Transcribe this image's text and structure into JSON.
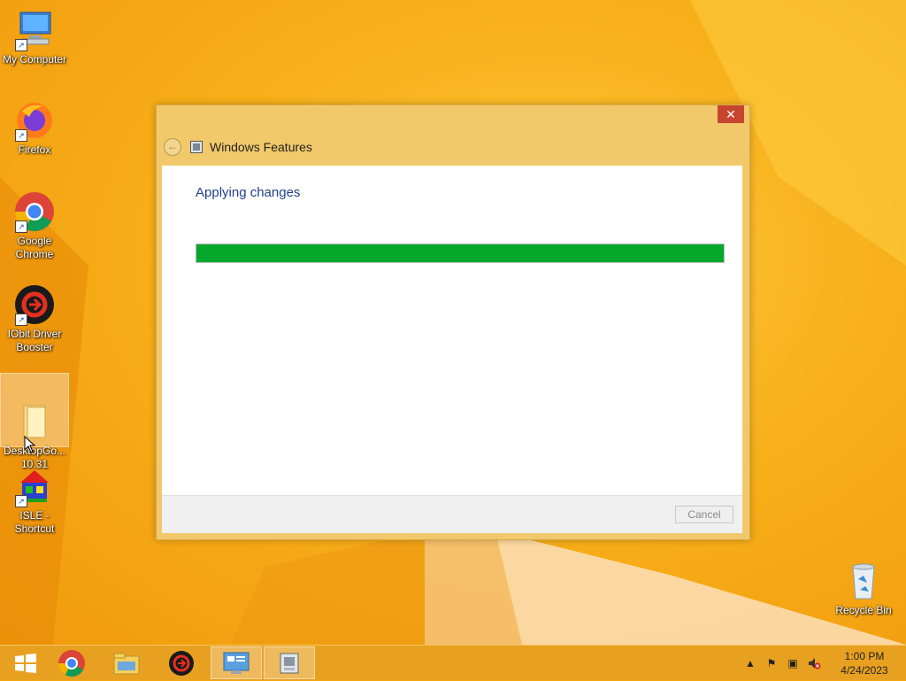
{
  "desktop": {
    "icons": [
      {
        "label": "My Computer"
      },
      {
        "label": "Firefox"
      },
      {
        "label": "Google Chrome"
      },
      {
        "label": "IObit Driver Booster"
      },
      {
        "label": "DesktopGo...\n10.31"
      },
      {
        "label": "ISLE - Shortcut"
      },
      {
        "label": "Recycle Bin"
      }
    ]
  },
  "dialog": {
    "title": "Windows Features",
    "heading": "Applying changes",
    "progress": 1.0,
    "cancel_label": "Cancel",
    "close_label": "✕",
    "back_label": "←"
  },
  "taskbar": {
    "items": [
      "start-icon",
      "chrome-icon",
      "file-explorer-icon",
      "driver-booster-icon",
      "control-panel-icon",
      "windows-features-icon"
    ],
    "clock": {
      "time": "1:00 PM",
      "date": "4/24/2023"
    }
  },
  "colors": {
    "progress_fill": "#06a82c",
    "close_button": "#c7442f",
    "heading": "#1e3f8a"
  }
}
